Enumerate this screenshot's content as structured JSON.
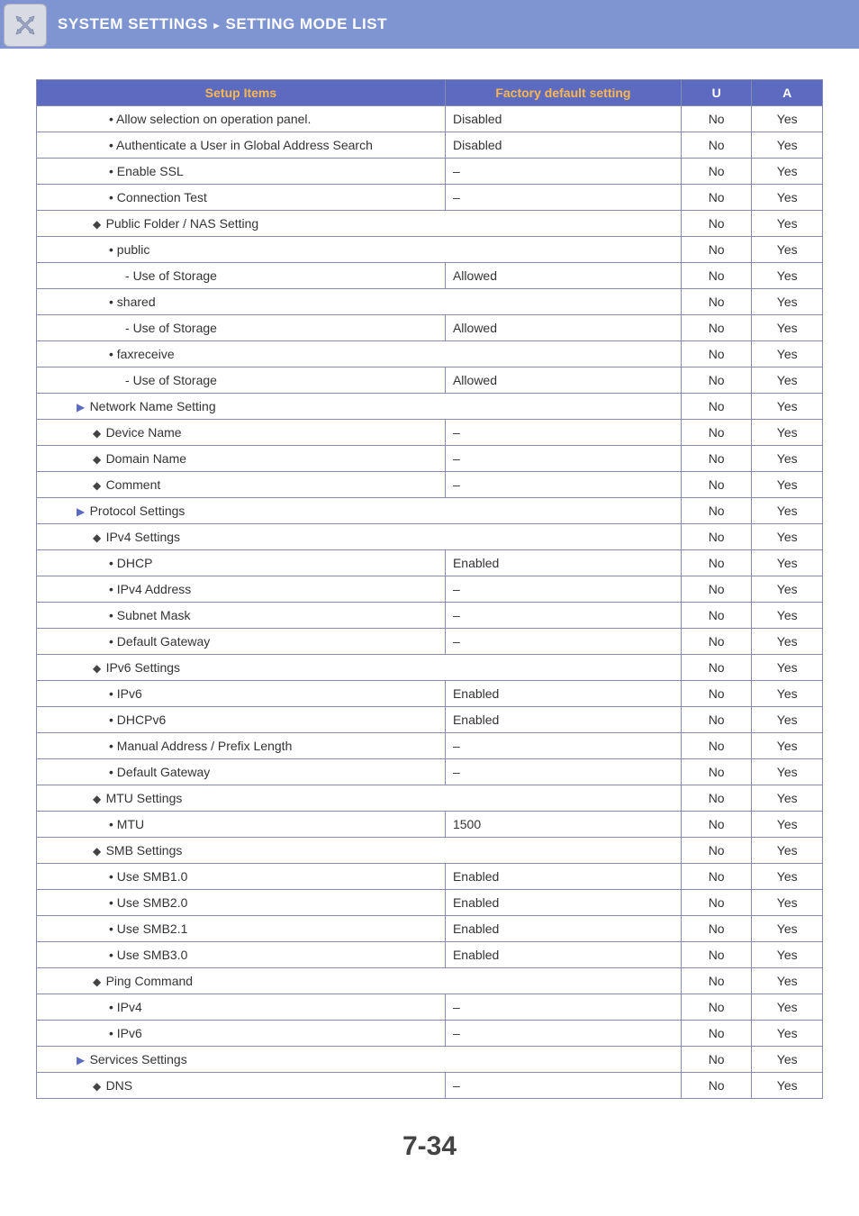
{
  "header": {
    "part1": "SYSTEM SETTINGS",
    "part2": "SETTING MODE LIST"
  },
  "columns": {
    "setup": "Setup Items",
    "factory": "Factory default setting",
    "u": "U",
    "a": "A"
  },
  "rows": [
    {
      "indent": 4,
      "sym": "•",
      "label": "Allow selection on operation panel.",
      "factory": "Disabled",
      "span": false,
      "u": "No",
      "a": "Yes"
    },
    {
      "indent": 4,
      "sym": "•",
      "label": "Authenticate a User in Global Address Search",
      "factory": "Disabled",
      "span": false,
      "u": "No",
      "a": "Yes"
    },
    {
      "indent": 4,
      "sym": "•",
      "label": "Enable SSL",
      "factory": "–",
      "span": false,
      "u": "No",
      "a": "Yes"
    },
    {
      "indent": 4,
      "sym": "•",
      "label": "Connection Test",
      "factory": "–",
      "span": false,
      "u": "No",
      "a": "Yes"
    },
    {
      "indent": 3,
      "sym": "◆",
      "label": "Public Folder / NAS Setting",
      "factory": "",
      "span": true,
      "u": "No",
      "a": "Yes"
    },
    {
      "indent": 4,
      "sym": "•",
      "label": "public",
      "factory": "",
      "span": true,
      "u": "No",
      "a": "Yes"
    },
    {
      "indent": 5,
      "sym": "-  ",
      "label": "Use of Storage",
      "factory": "Allowed",
      "span": false,
      "u": "No",
      "a": "Yes"
    },
    {
      "indent": 4,
      "sym": "•",
      "label": "shared",
      "factory": "",
      "span": true,
      "u": "No",
      "a": "Yes"
    },
    {
      "indent": 5,
      "sym": "-  ",
      "label": "Use of Storage",
      "factory": "Allowed",
      "span": false,
      "u": "No",
      "a": "Yes"
    },
    {
      "indent": 4,
      "sym": "•",
      "label": "faxreceive",
      "factory": "",
      "span": true,
      "u": "No",
      "a": "Yes"
    },
    {
      "indent": 5,
      "sym": "-  ",
      "label": "Use of Storage",
      "factory": "Allowed",
      "span": false,
      "u": "No",
      "a": "Yes"
    },
    {
      "indent": 2,
      "sym": "▶",
      "label": "Network Name Setting",
      "factory": "",
      "span": true,
      "u": "No",
      "a": "Yes"
    },
    {
      "indent": 3,
      "sym": "◆",
      "label": "Device Name",
      "factory": "–",
      "span": false,
      "u": "No",
      "a": "Yes"
    },
    {
      "indent": 3,
      "sym": "◆",
      "label": "Domain Name",
      "factory": "–",
      "span": false,
      "u": "No",
      "a": "Yes"
    },
    {
      "indent": 3,
      "sym": "◆",
      "label": "Comment",
      "factory": "–",
      "span": false,
      "u": "No",
      "a": "Yes"
    },
    {
      "indent": 2,
      "sym": "▶",
      "label": "Protocol Settings",
      "factory": "",
      "span": true,
      "u": "No",
      "a": "Yes"
    },
    {
      "indent": 3,
      "sym": "◆",
      "label": "IPv4 Settings",
      "factory": "",
      "span": true,
      "u": "No",
      "a": "Yes"
    },
    {
      "indent": 4,
      "sym": "•",
      "label": "DHCP",
      "factory": "Enabled",
      "span": false,
      "u": "No",
      "a": "Yes"
    },
    {
      "indent": 4,
      "sym": "•",
      "label": "IPv4 Address",
      "factory": "–",
      "span": false,
      "u": "No",
      "a": "Yes"
    },
    {
      "indent": 4,
      "sym": "•",
      "label": "Subnet Mask",
      "factory": "–",
      "span": false,
      "u": "No",
      "a": "Yes"
    },
    {
      "indent": 4,
      "sym": "•",
      "label": "Default Gateway",
      "factory": "–",
      "span": false,
      "u": "No",
      "a": "Yes"
    },
    {
      "indent": 3,
      "sym": "◆",
      "label": "IPv6 Settings",
      "factory": "",
      "span": true,
      "u": "No",
      "a": "Yes"
    },
    {
      "indent": 4,
      "sym": "•",
      "label": "IPv6",
      "factory": "Enabled",
      "span": false,
      "u": "No",
      "a": "Yes"
    },
    {
      "indent": 4,
      "sym": "•",
      "label": "DHCPv6",
      "factory": "Enabled",
      "span": false,
      "u": "No",
      "a": "Yes"
    },
    {
      "indent": 4,
      "sym": "•",
      "label": "Manual Address / Prefix Length",
      "factory": "–",
      "span": false,
      "u": "No",
      "a": "Yes"
    },
    {
      "indent": 4,
      "sym": "•",
      "label": "Default Gateway",
      "factory": "–",
      "span": false,
      "u": "No",
      "a": "Yes"
    },
    {
      "indent": 3,
      "sym": "◆",
      "label": "MTU Settings",
      "factory": "",
      "span": true,
      "u": "No",
      "a": "Yes"
    },
    {
      "indent": 4,
      "sym": "•",
      "label": "MTU",
      "factory": "1500",
      "span": false,
      "u": "No",
      "a": "Yes"
    },
    {
      "indent": 3,
      "sym": "◆",
      "label": "SMB Settings",
      "factory": "",
      "span": true,
      "u": "No",
      "a": "Yes"
    },
    {
      "indent": 4,
      "sym": "•",
      "label": "Use SMB1.0",
      "factory": "Enabled",
      "span": false,
      "u": "No",
      "a": "Yes"
    },
    {
      "indent": 4,
      "sym": "•",
      "label": "Use SMB2.0",
      "factory": "Enabled",
      "span": false,
      "u": "No",
      "a": "Yes"
    },
    {
      "indent": 4,
      "sym": "•",
      "label": "Use SMB2.1",
      "factory": "Enabled",
      "span": false,
      "u": "No",
      "a": "Yes"
    },
    {
      "indent": 4,
      "sym": "•",
      "label": "Use SMB3.0",
      "factory": "Enabled",
      "span": false,
      "u": "No",
      "a": "Yes"
    },
    {
      "indent": 3,
      "sym": "◆",
      "label": "Ping Command",
      "factory": "",
      "span": true,
      "u": "No",
      "a": "Yes"
    },
    {
      "indent": 4,
      "sym": "•",
      "label": "IPv4",
      "factory": "–",
      "span": false,
      "u": "No",
      "a": "Yes"
    },
    {
      "indent": 4,
      "sym": "•",
      "label": "IPv6",
      "factory": "–",
      "span": false,
      "u": "No",
      "a": "Yes"
    },
    {
      "indent": 2,
      "sym": "▶",
      "label": "Services Settings",
      "factory": "",
      "span": true,
      "u": "No",
      "a": "Yes"
    },
    {
      "indent": 3,
      "sym": "◆",
      "label": "DNS",
      "factory": "–",
      "span": false,
      "u": "No",
      "a": "Yes"
    }
  ],
  "page": "7-34"
}
